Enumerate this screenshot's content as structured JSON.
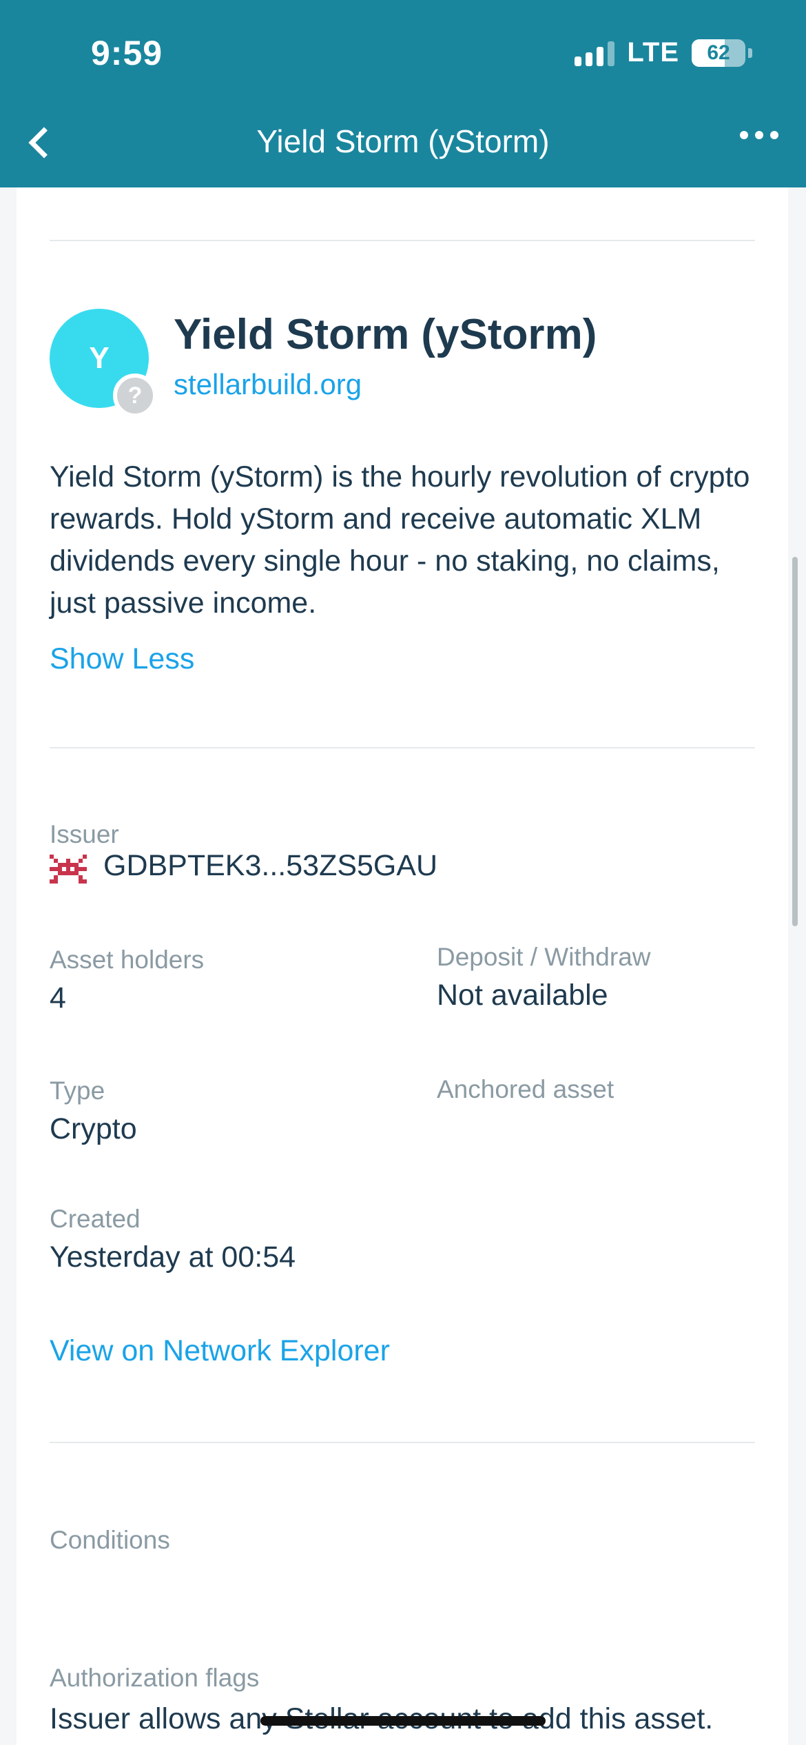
{
  "status_bar": {
    "time": "9:59",
    "network": "LTE",
    "battery": "62",
    "battery_level": 0.62
  },
  "nav": {
    "title": "Yield Storm (yStorm)",
    "back_icon": "chevron-left-icon",
    "more_icon": "more-horizontal-icon"
  },
  "asset": {
    "avatar_letter": "Y",
    "avatar_color": "#38dbee",
    "badge_symbol": "?",
    "name": "Yield Storm (yStorm)",
    "domain": "stellarbuild.org",
    "description": "Yield Storm (yStorm) is the hourly revolution of crypto rewards. Hold yStorm and receive automatic XLM dividends every single hour - no staking, no claims, just passive income.",
    "show_less_label": "Show Less"
  },
  "details": {
    "issuer_label": "Issuer",
    "issuer_value": "GDBPTEK3...53ZS5GAU",
    "issuer_icon_color": "#c9344d",
    "holders_label": "Asset holders",
    "holders_value": "4",
    "deposit_label": "Deposit / Withdraw",
    "deposit_value": "Not available",
    "type_label": "Type",
    "type_value": "Crypto",
    "anchored_label": "Anchored asset",
    "created_label": "Created",
    "created_value": "Yesterday at 00:54",
    "explorer_link": "View on Network Explorer"
  },
  "conditions": {
    "title": "Conditions",
    "auth_flags_label": "Authorization flags",
    "auth_flags_value": "Issuer allows any Stellar account to add this asset."
  },
  "colors": {
    "header": "#1a869e",
    "accent": "#1aa3e8",
    "text": "#1e3a4f",
    "muted": "#8a9aa3"
  }
}
